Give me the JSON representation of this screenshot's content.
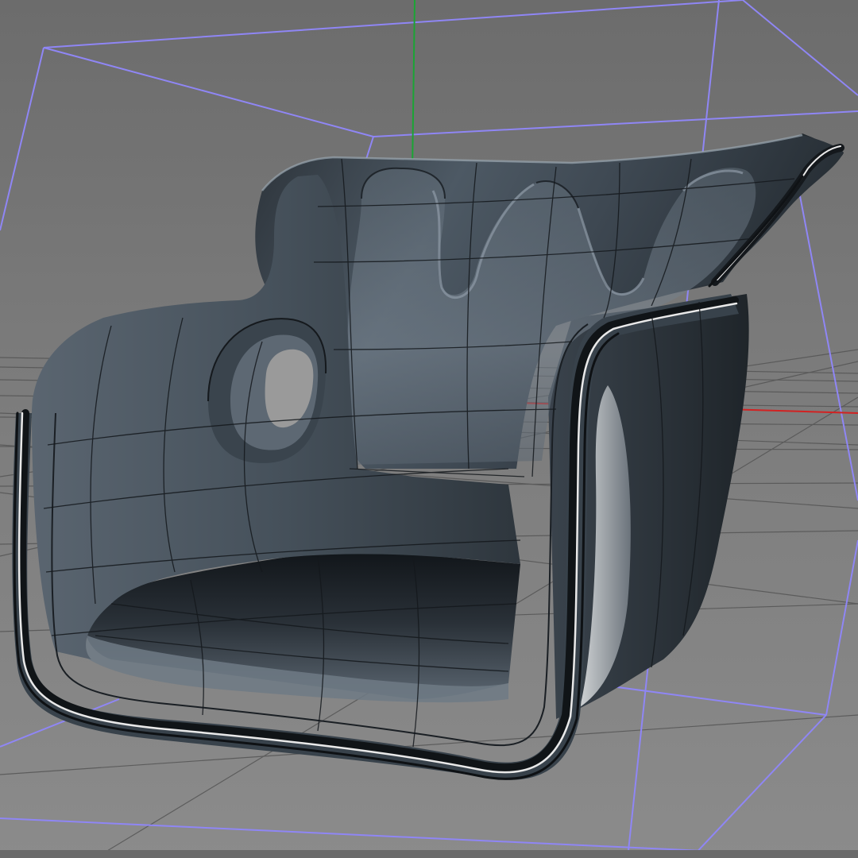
{
  "viewport": {
    "view": "perspective",
    "colors": {
      "background_top": "#6e6e6e",
      "background_bottom": "#8a8a8a",
      "floor_grid": "#555555",
      "bounding_box": "#8f86f5",
      "axis_x": "#d22222",
      "axis_y": "#1aa534",
      "axis_z": "#2b3fd6",
      "mesh_dark": "#2b3138",
      "mesh_mid": "#4a5560",
      "mesh_light": "#7d8a96",
      "wireframe": "#14181c",
      "highlight_stripe": "#e9e9e9"
    }
  },
  "scene": {
    "object": "seat-shell-subdivision-mesh",
    "selected": true,
    "display_mode": "shaded-with-wireframe"
  }
}
